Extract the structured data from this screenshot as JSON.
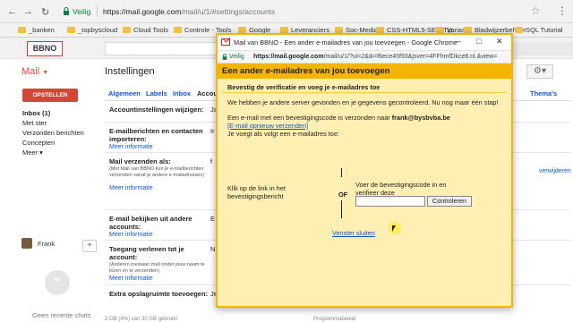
{
  "browser": {
    "secure_label": "Veilig",
    "url_host": "https://mail.google.com",
    "url_path": "/mail/u/1/#settings/accounts",
    "bookmarks": [
      "_banken",
      "_topbyscloud",
      "Cloud Tools",
      "Controle - Tools",
      "Google",
      "Leveranciers",
      "Soc-Media",
      "CSS-HTML5-SEO-Tip",
      "Varias",
      "Bladwijzerbeheer",
      "SQL Tutorial"
    ]
  },
  "gmail": {
    "logo_text": "BBNO",
    "mail_label": "Mail",
    "page_title": "Instellingen",
    "compose_label": "OPSTELLEN",
    "nav": [
      "Inbox (1)",
      "Met ster",
      "Verzonden berichten",
      "Concepten",
      "Meer ▾"
    ],
    "profile_name": "Frank",
    "no_chats": "Geen recente chats",
    "tabs": [
      "Algemeen",
      "Labels",
      "Inbox",
      "Accou",
      "Thema's"
    ],
    "rows": [
      {
        "label": "Accountinstellingen wijzigen:",
        "value": "Ja"
      },
      {
        "label": "E-mailberichten en contacten importeren:",
        "link": "Meer informatie",
        "value": "Ir"
      },
      {
        "label": "Mail verzenden als:",
        "small": "(Met Mail van BBNO kun je e-mailberichten verzenden vanaf je andere e-mailadressen)",
        "link": "Meer informatie",
        "value": "f"
      },
      {
        "label": "E-mail bekijken uit andere accounts:",
        "link": "Meer informatie",
        "value": "E"
      },
      {
        "label": "Toegang verlenen tot je account:",
        "small": "(Anderen toestaan mail onder jouw naam te lezen en te verzenden)",
        "link": "Meer informatie",
        "value": "N"
      },
      {
        "label": "Extra opslagruimte toevoegen:",
        "value": "Je"
      }
    ],
    "right_link_edit": "verwijderen",
    "footer_left": "2 GB (4%) van 30 GB gebruikt",
    "footer_mid": "Programmabeleid"
  },
  "popup": {
    "window_title": "Mail van BBNO - Een ander e-mailadres van jou toevoegen - Google Chrome",
    "secure_label": "Veilig",
    "url_host": "https://mail.google.com",
    "url_path": "/mail/u/1/?ui=2&ik=f6ece45f93&jsver=4FFhmfDkce8.nl.&view=",
    "heading": "Een ander e-mailadres van jou toevoegen",
    "step_title": "Bevestig de verificatie en voeg je e-mailadres toe",
    "info_line": "We hebben je andere server gevonden en je gegevens gecontroleerd. Nu nog maar één stap!",
    "sent_prefix": "Een e-mail met een bevestigingscode is verzonden naar",
    "sent_email": "frank@bysbvba.be",
    "resend_link": "[E-mail opnieuw verzenden]",
    "adding_line": "Je voegt als volgt een e-mailadres toe:",
    "left_instruction": "Klik op de link in het bevestigingsbericht",
    "or_label": "OF",
    "right_instruction": "Voer de bevestigingscode in en verifieer deze",
    "code_value": "",
    "verify_button": "Controleren",
    "close_link": "Venster sluiten"
  },
  "colors": {
    "accent_red": "#d14836",
    "popup_yellow": "#f4b400",
    "popup_body": "#ffefb3",
    "link_blue": "#1155cc"
  }
}
